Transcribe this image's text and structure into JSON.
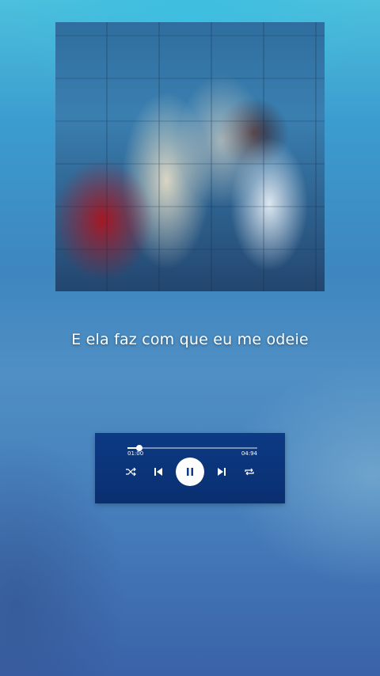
{
  "lyrics": {
    "line": "E ela faz com que eu me odeie"
  },
  "player": {
    "current_time": "01:00",
    "total_time": "04:94",
    "progress": 0.09,
    "icons": {
      "shuffle": "shuffle-icon",
      "previous": "skip-previous-icon",
      "play_pause": "pause-icon",
      "next": "skip-next-icon",
      "repeat": "repeat-icon"
    },
    "colors": {
      "panel": "#0c3a84",
      "controls": "#ffffff"
    }
  }
}
